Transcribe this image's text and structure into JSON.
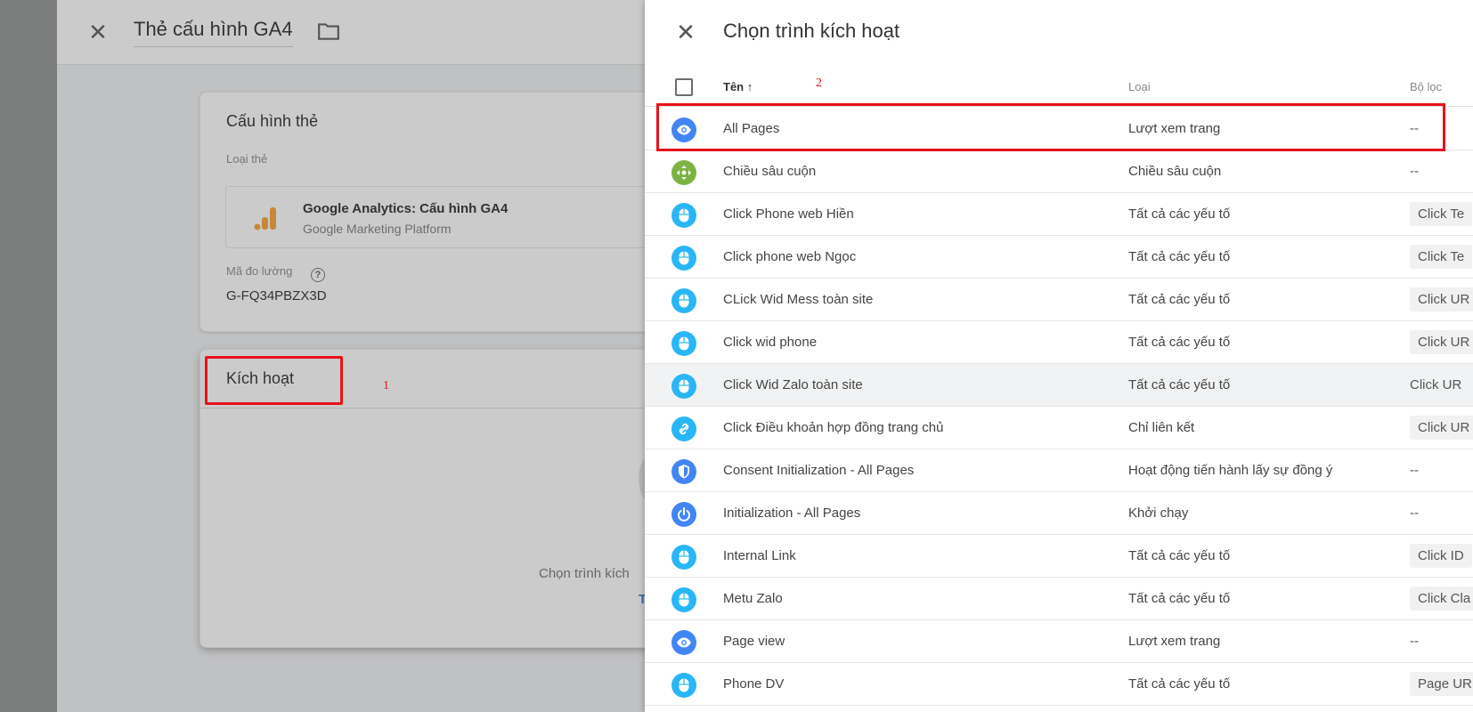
{
  "topbar": {
    "close_icon": "close-icon",
    "title": "Thẻ cấu hình GA4",
    "folder_icon": "folder-icon"
  },
  "tag_config": {
    "heading": "Cấu hình thẻ",
    "type_label": "Loại thẻ",
    "tag_type": {
      "icon": "google-analytics-icon",
      "name": "Google Analytics: Cấu hình GA4",
      "vendor": "Google Marketing Platform"
    },
    "measurement_id_label": "Mã đo lường",
    "help_icon": "?",
    "measurement_id": "G-FQ34PBZX3D"
  },
  "triggering": {
    "heading": "Kích hoạt",
    "choose_text": "Chọn trình kích",
    "add_link": "T"
  },
  "annotations": {
    "one": "1",
    "two": "2",
    "color": "#e8121b"
  },
  "panel": {
    "title": "Chọn trình kích hoạt",
    "columns": {
      "name": "Tên",
      "sort_icon": "↑",
      "type": "Loại",
      "filter": "Bộ lọc"
    },
    "rows": [
      {
        "name": "All Pages",
        "type": "Lượt xem trang",
        "filter": "--",
        "icon": "eye",
        "color": "#4285f4",
        "chip": false
      },
      {
        "name": "Chiều sâu cuộn",
        "type": "Chiều sâu cuộn",
        "filter": "--",
        "icon": "move",
        "color": "#7cb342",
        "chip": false
      },
      {
        "name": "Click Phone web Hiền",
        "type": "Tất cả các yếu tố",
        "filter": "Click Te",
        "icon": "mouse",
        "color": "#29b6f6",
        "chip": true
      },
      {
        "name": "Click phone web Ngọc",
        "type": "Tất cả các yếu tố",
        "filter": "Click Te",
        "icon": "mouse",
        "color": "#29b6f6",
        "chip": true
      },
      {
        "name": "CLick Wid Mess toàn site",
        "type": "Tất cả các yếu tố",
        "filter": "Click UR",
        "icon": "mouse",
        "color": "#29b6f6",
        "chip": true
      },
      {
        "name": "Click wid phone",
        "type": "Tất cả các yếu tố",
        "filter": "Click UR",
        "icon": "mouse",
        "color": "#29b6f6",
        "chip": true
      },
      {
        "name": "Click Wid Zalo toàn site",
        "type": "Tất cả các yếu tố",
        "filter": "Click UR",
        "icon": "mouse",
        "color": "#29b6f6",
        "chip": false
      },
      {
        "name": "Click Điều khoản hợp đồng trang chủ",
        "type": "Chỉ liên kết",
        "filter": "Click UR",
        "icon": "link",
        "color": "#29b6f6",
        "chip": true
      },
      {
        "name": "Consent Initialization - All Pages",
        "type": "Hoạt động tiến hành lấy sự đồng ý",
        "filter": "--",
        "icon": "shield",
        "color": "#4285f4",
        "chip": false
      },
      {
        "name": "Initialization - All Pages",
        "type": "Khởi chạy",
        "filter": "--",
        "icon": "power",
        "color": "#4285f4",
        "chip": false
      },
      {
        "name": "Internal Link",
        "type": "Tất cả các yếu tố",
        "filter": "Click ID",
        "icon": "mouse",
        "color": "#29b6f6",
        "chip": true
      },
      {
        "name": "Metu Zalo",
        "type": "Tất cả các yếu tố",
        "filter": "Click Cla",
        "icon": "mouse",
        "color": "#29b6f6",
        "chip": true
      },
      {
        "name": "Page view",
        "type": "Lượt xem trang",
        "filter": "--",
        "icon": "eye",
        "color": "#4285f4",
        "chip": false
      },
      {
        "name": "Phone DV",
        "type": "Tất cả các yếu tố",
        "filter": "Page UR",
        "icon": "mouse",
        "color": "#29b6f6",
        "chip": true
      }
    ],
    "hovered_row": 6
  }
}
